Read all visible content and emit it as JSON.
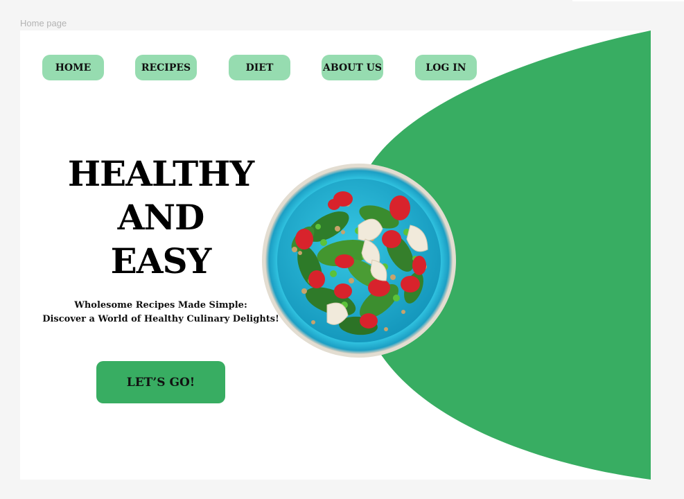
{
  "frame": {
    "label": "Home page"
  },
  "colors": {
    "accent_green": "#38ad62",
    "nav_green": "#96dcb0",
    "bowl_blue": "#1fb4d6",
    "page_background": "#ffffff",
    "canvas_background": "#f5f5f5"
  },
  "nav": {
    "items": [
      {
        "label": "HOME"
      },
      {
        "label": "RECIPES"
      },
      {
        "label": "DIET"
      },
      {
        "label": "ABOUT US"
      },
      {
        "label": "LOG IN"
      }
    ]
  },
  "hero": {
    "title_lines": [
      "HEALTHY",
      "AND",
      "EASY"
    ],
    "subtitle_lines": [
      "Wholesome Recipes Made Simple:",
      "Discover a World of Healthy Culinary Delights!"
    ],
    "cta_label": "LET’S GO!"
  },
  "image": {
    "icon": "salad-bowl-image"
  }
}
